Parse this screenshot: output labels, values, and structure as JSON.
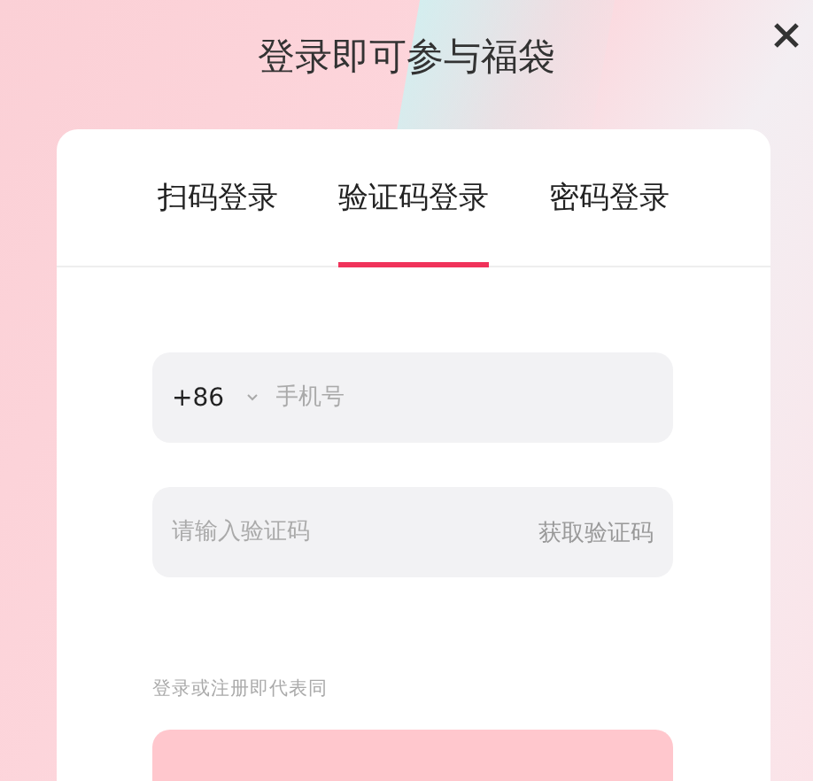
{
  "title": "登录即可参与福袋",
  "tabs": [
    {
      "label": "扫码登录",
      "selected": false
    },
    {
      "label": "验证码登录",
      "selected": true
    },
    {
      "label": "密码登录",
      "selected": false
    }
  ],
  "phone_field": {
    "country_code": "+86",
    "placeholder": "手机号"
  },
  "code_field": {
    "placeholder": "请输入验证码",
    "action": "获取验证码"
  },
  "agreement": "登录或注册即代表同"
}
